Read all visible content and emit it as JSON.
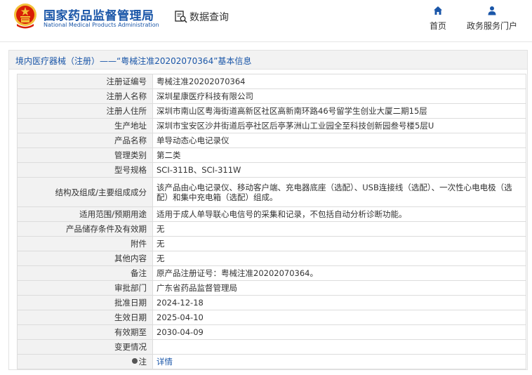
{
  "header": {
    "brand_cn": "国家药品监督管理局",
    "brand_en": "National Medical Products Administration",
    "query_label": "数据查询",
    "nav": [
      {
        "label": "首页",
        "icon": "home-icon"
      },
      {
        "label": "政务服务门户",
        "icon": "user-icon"
      }
    ],
    "colors": {
      "brand": "#1a56a8",
      "emblem_red": "#d81e06",
      "emblem_gold": "#f3c13a"
    }
  },
  "breadcrumb": {
    "text": "境内医疗器械（注册）——“粤械注准20202070364”基本信息"
  },
  "record": {
    "rows": [
      {
        "label": "注册证编号",
        "value": "粤械注准20202070364"
      },
      {
        "label": "注册人名称",
        "value": "深圳星康医疗科技有限公司"
      },
      {
        "label": "注册人住所",
        "value": "深圳市南山区粤海街道高新区社区高新南环路46号留学生创业大厦二期15层"
      },
      {
        "label": "生产地址",
        "value": "深圳市宝安区沙井街道后亭社区后亭茅洲山工业园全至科技创新园叁号楼5层U"
      },
      {
        "label": "产品名称",
        "value": "单导动态心电记录仪"
      },
      {
        "label": "管理类别",
        "value": "第二类"
      },
      {
        "label": "型号规格",
        "value": "SCI-311B、SCI-311W"
      },
      {
        "label": "结构及组成/主要组成成分",
        "value": "该产品由心电记录仪、移动客户端、充电器底座（选配）、USB连接线（选配）、一次性心电电极（选配）和集中充电箱（选配）组成。"
      },
      {
        "label": "适用范围/预期用途",
        "value": "适用于成人单导联心电信号的采集和记录，不包括自动分析诊断功能。"
      },
      {
        "label": "产品储存条件及有效期",
        "value": "无"
      },
      {
        "label": "附件",
        "value": "无"
      },
      {
        "label": "其他内容",
        "value": "无"
      },
      {
        "label": "备注",
        "value": "原产品注册证号：粤械注准20202070364。"
      },
      {
        "label": "审批部门",
        "value": "广东省药品监督管理局"
      },
      {
        "label": "批准日期",
        "value": "2024-12-18"
      },
      {
        "label": "生效日期",
        "value": "2025-04-10"
      },
      {
        "label": "有效期至",
        "value": "2030-04-09"
      },
      {
        "label": "变更情况",
        "value": ""
      },
      {
        "label": "注",
        "value": "详情"
      }
    ]
  }
}
